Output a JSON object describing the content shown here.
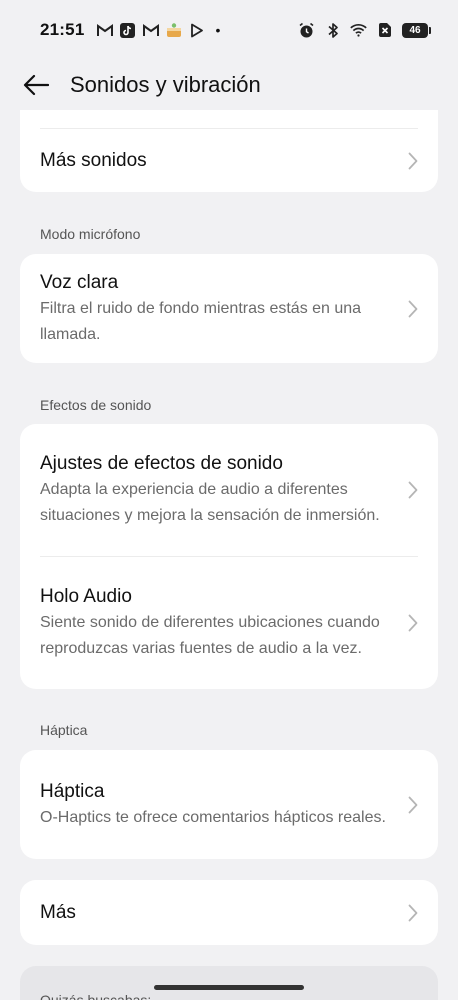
{
  "status_bar": {
    "time": "21:51",
    "notification_icons": [
      "gmail-icon",
      "tiktok-icon",
      "gmail-icon",
      "cake-app-icon",
      "play-store-icon"
    ],
    "dot": "•",
    "battery": "46"
  },
  "header": {
    "title": "Sonidos y vibración"
  },
  "sections": {
    "top_card": {
      "item_label": "Más sonidos"
    },
    "mic": {
      "label": "Modo micrófono",
      "item_title": "Voz clara",
      "item_sub": "Filtra el ruido de fondo mientras estás en una llamada."
    },
    "effects": {
      "label": "Efectos de sonido",
      "item1_title": "Ajustes de efectos de sonido",
      "item1_sub": "Adapta la experiencia de audio a diferentes situaciones y mejora la sensación de inmersión.",
      "item2_title": "Holo Audio",
      "item2_sub": "Siente sonido de diferentes ubicaciones cuando reproduzcas varias fuentes de audio a la vez."
    },
    "haptics": {
      "label": "Háptica",
      "item_title": "Háptica",
      "item_sub": "O-Haptics te ofrece comentarios hápticos reales."
    },
    "more": {
      "item_label": "Más"
    },
    "search": {
      "label": "Quizás buscabas:"
    }
  },
  "colors": {
    "background": "#f1f1f3",
    "card": "#ffffff",
    "subtext": "#6b6b6b"
  }
}
